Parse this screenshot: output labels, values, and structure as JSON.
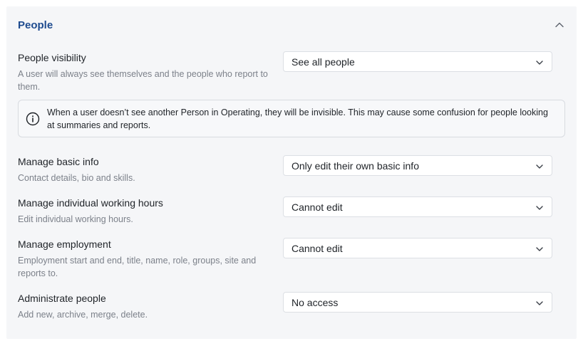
{
  "section": {
    "title": "People",
    "collapse_icon": "chevron-up-icon"
  },
  "settings": [
    {
      "label": "People visibility",
      "description": "A user will always see themselves and the people who report to them.",
      "value": "See all people"
    },
    {
      "label": "Manage basic info",
      "description": "Contact details, bio and skills.",
      "value": "Only edit their own basic info"
    },
    {
      "label": "Manage individual working hours",
      "description": "Edit individual working hours.",
      "value": "Cannot edit"
    },
    {
      "label": "Manage employment",
      "description": "Employment start and end, title, name, role, groups, site and reports to.",
      "value": "Cannot edit"
    },
    {
      "label": "Administrate people",
      "description": "Add new, archive, merge, delete.",
      "value": "No access"
    }
  ],
  "notice": {
    "icon": "info-icon",
    "text": "When a user doesn’t see another Person in Operating, they will be invisible. This may cause some confusion for people looking at summaries and reports."
  },
  "icons": {
    "dropdown": "chevron-down-icon"
  },
  "colors": {
    "title": "#1e4b8f",
    "panel_bg": "#f5f6f8",
    "description": "#7c818a",
    "border": "#dcdfe4"
  }
}
